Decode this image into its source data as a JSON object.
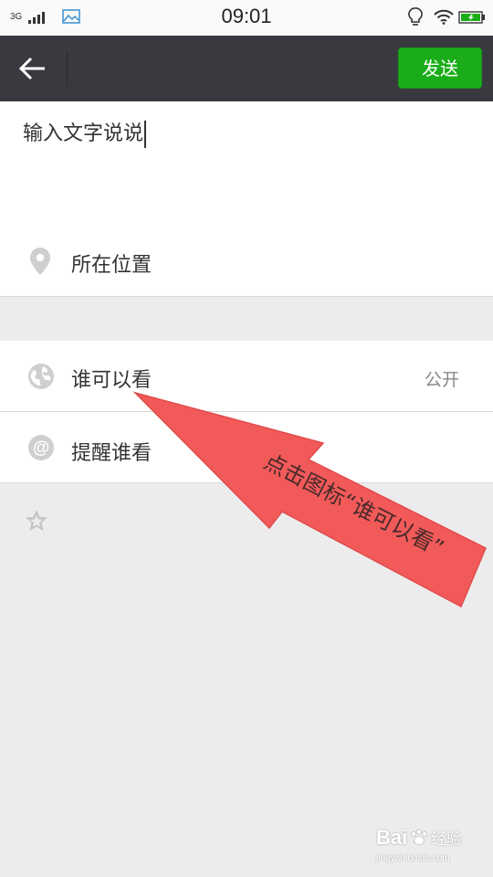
{
  "status_bar": {
    "network": "3G",
    "time": "09:01",
    "signal_icon": "signal-icon",
    "gallery_icon": "gallery-icon",
    "bulb_icon": "bulb-icon",
    "wifi_icon": "wifi-icon",
    "battery_icon": "battery-icon"
  },
  "header": {
    "back_icon": "back-arrow-icon",
    "send_label": "发送",
    "send_color": "#1aad19",
    "bar_color": "#393a3f"
  },
  "composer": {
    "text": "输入文字说说"
  },
  "location": {
    "icon": "location-pin-icon",
    "label": "所在位置"
  },
  "visibility": {
    "icon": "globe-icon",
    "label": "谁可以看",
    "value": "公开"
  },
  "remind": {
    "icon": "at-icon",
    "label": "提醒谁看"
  },
  "extra": {
    "icon": "star-icon"
  },
  "annotation": {
    "text": "点击图标“谁可以看”",
    "color": "#f25a5a"
  },
  "watermark": {
    "brand": "Bai",
    "brand2": "经验",
    "sub": "jingyan.baidu.com"
  }
}
